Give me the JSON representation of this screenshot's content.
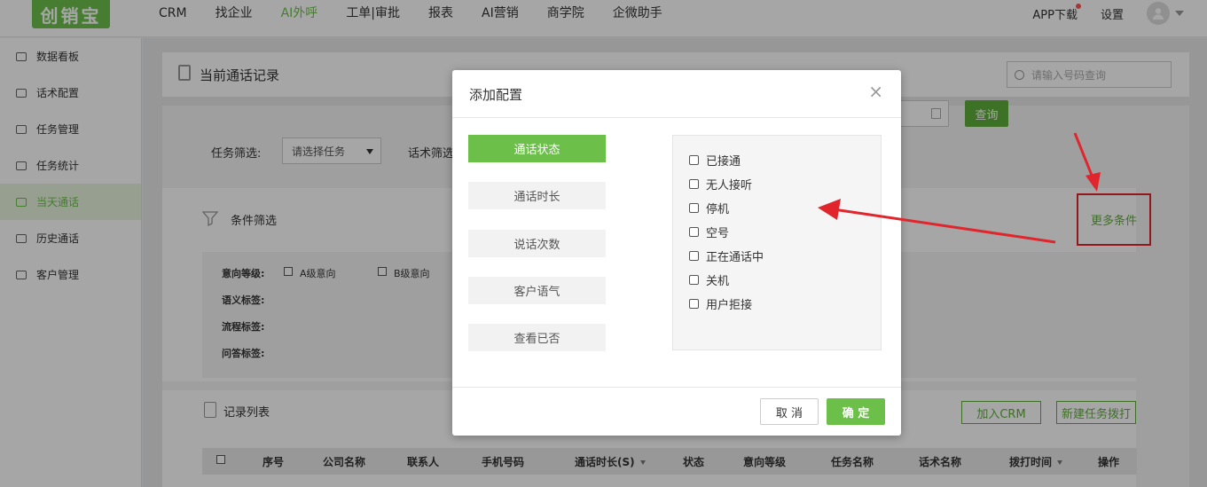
{
  "app": {
    "logo": "创销宝"
  },
  "nav": {
    "items": [
      {
        "label": "CRM",
        "active": false
      },
      {
        "label": "找企业",
        "active": false
      },
      {
        "label": "AI外呼",
        "active": true
      },
      {
        "label": "工单|审批",
        "active": false
      },
      {
        "label": "报表",
        "active": false
      },
      {
        "label": "AI营销",
        "active": false
      },
      {
        "label": "商学院",
        "active": false
      },
      {
        "label": "企微助手",
        "active": false
      }
    ],
    "app_download": "APP下载",
    "settings": "设置"
  },
  "sidebar": {
    "items": [
      {
        "label": "数据看板",
        "active": false
      },
      {
        "label": "话术配置",
        "active": false
      },
      {
        "label": "任务管理",
        "active": false
      },
      {
        "label": "任务统计",
        "active": false
      },
      {
        "label": "当天通话",
        "active": true
      },
      {
        "label": "历史通话",
        "active": false
      },
      {
        "label": "客户管理",
        "active": false
      }
    ]
  },
  "main": {
    "title": "当前通话记录",
    "search_placeholder": "请输入号码查询",
    "task_filter_label": "任务筛选:",
    "task_select_value": "请选择任务",
    "script_filter_label": "话术筛选",
    "query_button": "查询",
    "condition_title": "条件筛选",
    "more_conditions": "更多条件",
    "intent_label": "意向等级:",
    "intent_a": "A级意向",
    "intent_b": "B级意向",
    "semantic_label": "语义标签:",
    "flow_label": "流程标签:",
    "qa_label": "问答标签:",
    "records_title": "记录列表",
    "add_crm_button": "加入CRM",
    "new_task_button": "新建任务拨打",
    "table_headers": [
      "序号",
      "公司名称",
      "联系人",
      "手机号码",
      "通话时长(S)",
      "状态",
      "意向等级",
      "任务名称",
      "话术名称",
      "拨打时间",
      "操作"
    ]
  },
  "modal": {
    "title": "添加配置",
    "close": "×",
    "tabs": [
      {
        "label": "通话状态",
        "active": true
      },
      {
        "label": "通话时长",
        "active": false
      },
      {
        "label": "说话次数",
        "active": false
      },
      {
        "label": "客户语气",
        "active": false
      },
      {
        "label": "查看已否",
        "active": false
      }
    ],
    "options": [
      "已接通",
      "无人接听",
      "停机",
      "空号",
      "正在通话中",
      "关机",
      "用户拒接"
    ],
    "cancel": "取 消",
    "confirm": "确 定"
  },
  "colors": {
    "brand": "#6cc04a",
    "annotation": "#e0262c"
  }
}
